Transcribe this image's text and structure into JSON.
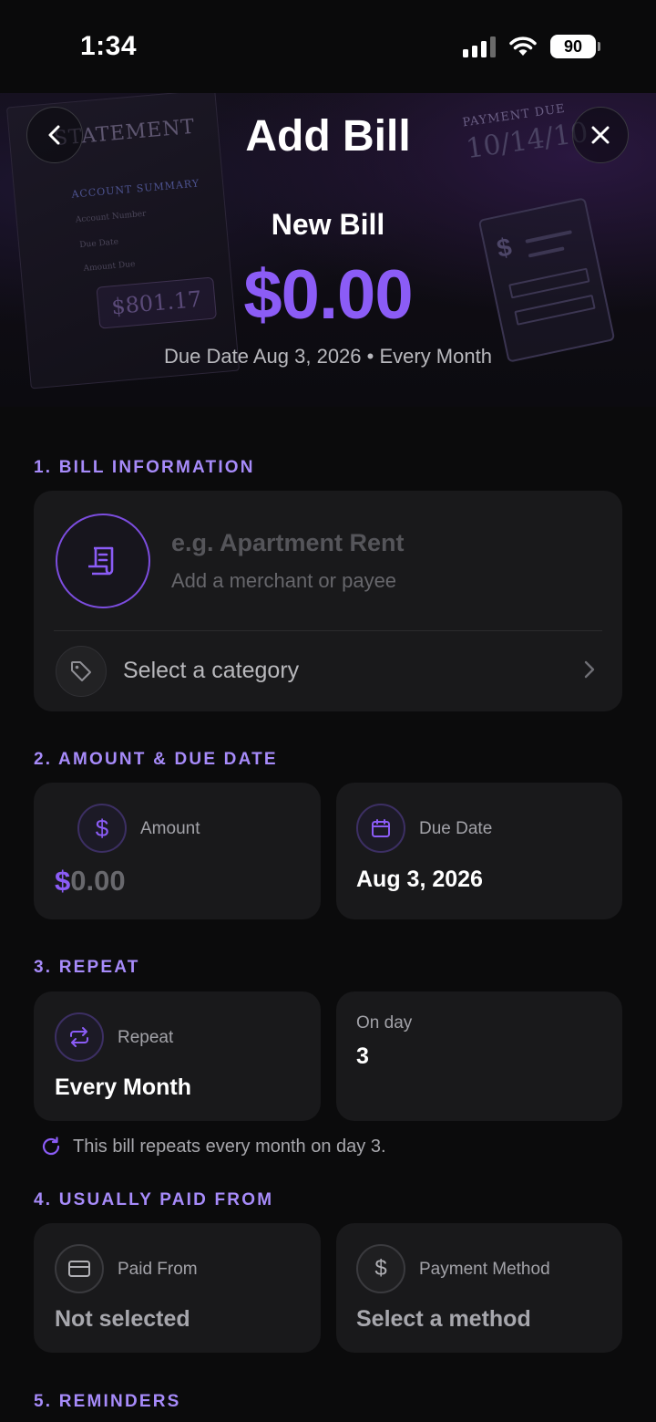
{
  "status_bar": {
    "time": "1:34",
    "battery": "90"
  },
  "header": {
    "title": "Add Bill",
    "subtitle": "New Bill",
    "amount": "$0.00",
    "due_line": "Due Date Aug 3, 2026 • Every Month"
  },
  "hero_art": {
    "statement": "STATEMENT",
    "account_summary": "ACCOUNT SUMMARY",
    "account_number": "Account Number",
    "due_date": "Due Date",
    "amount_due": "Amount Due",
    "statement_amount": "$801.17",
    "payment_due": "PAYMENT DUE",
    "payment_due_date": "10/14/10"
  },
  "sections": {
    "bill_info": "1. BILL INFORMATION",
    "amount_due": "2. AMOUNT & DUE DATE",
    "repeat": "3. REPEAT",
    "paid_from": "4. USUALLY PAID FROM",
    "reminders": "5. REMINDERS"
  },
  "bill_info": {
    "name_placeholder": "e.g. Apartment Rent",
    "payee_placeholder": "Add a merchant or payee",
    "category": "Select a category"
  },
  "amount_card": {
    "label": "Amount",
    "symbol": "$",
    "value": "0.00"
  },
  "due_card": {
    "label": "Due Date",
    "value": "Aug 3, 2026"
  },
  "repeat_card": {
    "label": "Repeat",
    "value": "Every Month"
  },
  "on_day_card": {
    "label": "On day",
    "value": "3"
  },
  "repeat_note": "This bill repeats every month on day 3.",
  "paid_from_card": {
    "label": "Paid From",
    "value": "Not selected"
  },
  "method_card": {
    "label": "Payment Method",
    "value": "Select a method"
  },
  "colors": {
    "accent": "#8b5cf6",
    "section_label": "#a78bfa",
    "card": "#19191b",
    "background": "#0b0b0c"
  }
}
